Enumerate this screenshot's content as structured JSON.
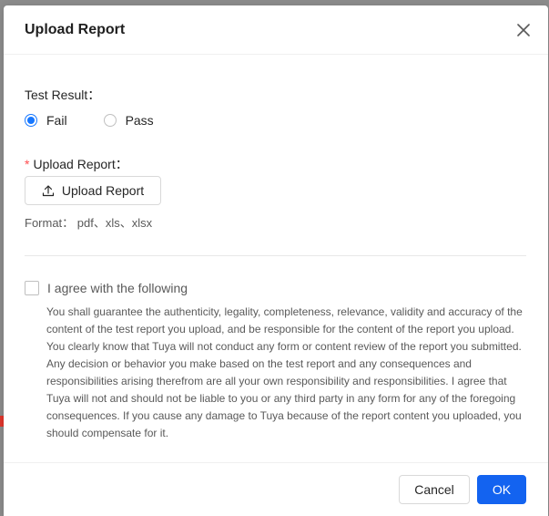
{
  "modal": {
    "title": "Upload Report"
  },
  "test_result": {
    "label": "Test Result：",
    "options": [
      {
        "label": "Fail",
        "checked": true
      },
      {
        "label": "Pass",
        "checked": false
      }
    ]
  },
  "upload": {
    "required_mark": "*",
    "label": "Upload Report：",
    "button_label": "Upload Report",
    "format_text": "Format： pdf、xls、xlsx"
  },
  "agreement": {
    "checkbox_label": "I agree with the following",
    "checked": false,
    "text": "You shall guarantee the authenticity, legality, completeness, relevance, validity and accuracy of the content of the test report you upload, and be responsible for the content of the report you upload. You clearly know that Tuya will not conduct any form or content review of the report you submitted. Any decision or behavior you make based on the test report and any consequences and responsibilities arising therefrom are all your own responsibility and responsibilities. I agree that Tuya will not and should not be liable to you or any third party in any form for any of the foregoing consequences. If you cause any damage to Tuya because of the report content you uploaded, you should compensate for it."
  },
  "footer": {
    "cancel_label": "Cancel",
    "ok_label": "OK"
  },
  "colors": {
    "primary": "#1363f0",
    "required": "#ff4d4f"
  },
  "icons": {
    "close": "close-icon",
    "upload": "upload-icon"
  }
}
